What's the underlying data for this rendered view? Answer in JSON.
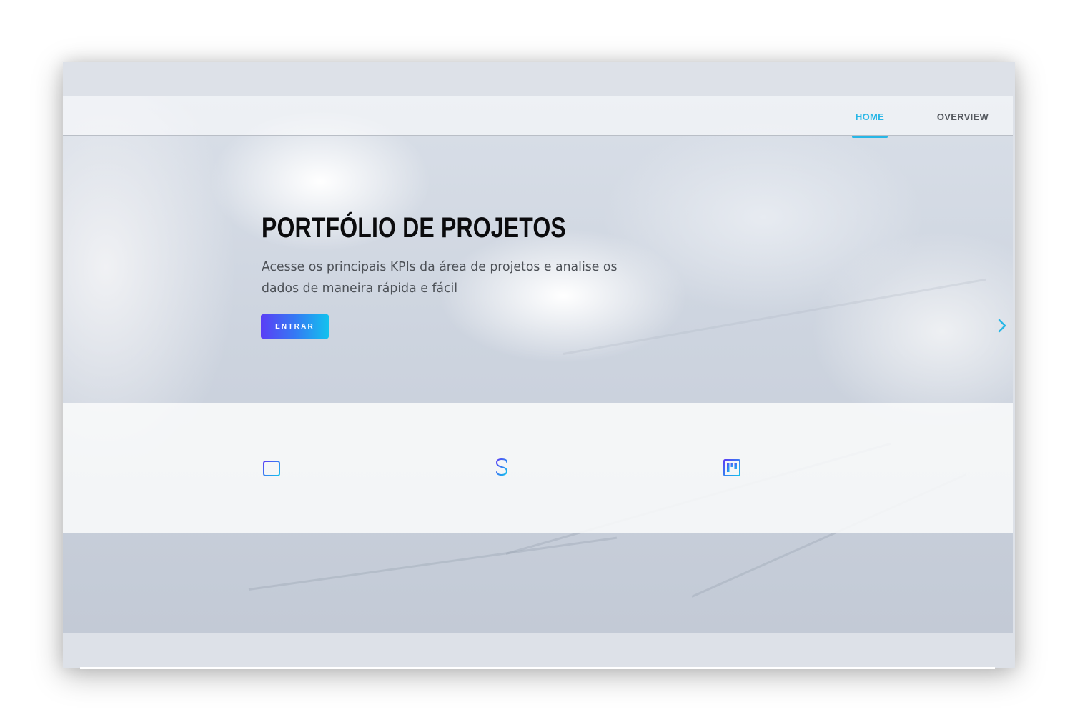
{
  "nav": {
    "items": [
      {
        "label": "HOME",
        "active": true
      },
      {
        "label": "OVERVIEW",
        "active": false
      }
    ],
    "accent_color": "#27b6e6"
  },
  "hero": {
    "title": "PORTFÓLIO DE PROJETOS",
    "subtitle": "Acesse os principais KPIs da área de projetos e analise os dados de maneira rápida e fácil",
    "button_label": "ENTRAR",
    "button_gradient": [
      "#5a3ef5",
      "#12c2ee"
    ],
    "next_icon": "chevron-right-icon"
  },
  "features": {
    "icons": [
      "calendar-icon",
      "dollar-icon",
      "kanban-board-icon"
    ]
  }
}
